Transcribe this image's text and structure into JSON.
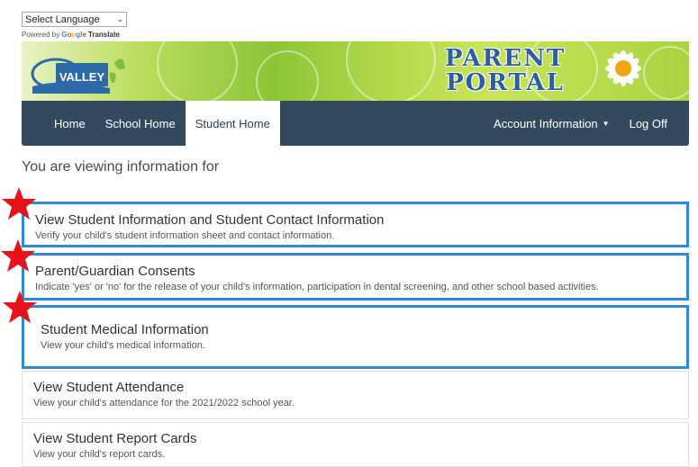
{
  "translate": {
    "select_label": "Select Language",
    "powered_by": "Powered by",
    "google": "Google",
    "translate": "Translate"
  },
  "banner": {
    "logo_text": "VALLEY",
    "title_line1": "PARENT",
    "title_line2": "PORTAL"
  },
  "nav": {
    "home": "Home",
    "school_home": "School Home",
    "student_home": "Student Home",
    "account_information": "Account Information",
    "log_off": "Log Off"
  },
  "main": {
    "viewing_text": "You are viewing information for",
    "items": [
      {
        "title": "View Student Information and Student Contact Information",
        "desc": "Verify your child's student information sheet and contact information."
      },
      {
        "title": "Parent/Guardian Consents",
        "desc": "Indicate 'yes' or 'no' for the release of your child's information, participation in dental screening, and other school based activities."
      },
      {
        "title": "Student Medical Information",
        "desc": "View your child's medical information."
      },
      {
        "title": "View Student Attendance",
        "desc": "View your child's attendance for the 2021/2022 school year."
      },
      {
        "title": "View Student Report Cards",
        "desc": "View your child's report cards."
      }
    ]
  },
  "colors": {
    "nav_bg": "#34495e",
    "highlight_border": "#2e8ad6",
    "star": "#e8121b",
    "banner_title": "#2c5f9e"
  }
}
